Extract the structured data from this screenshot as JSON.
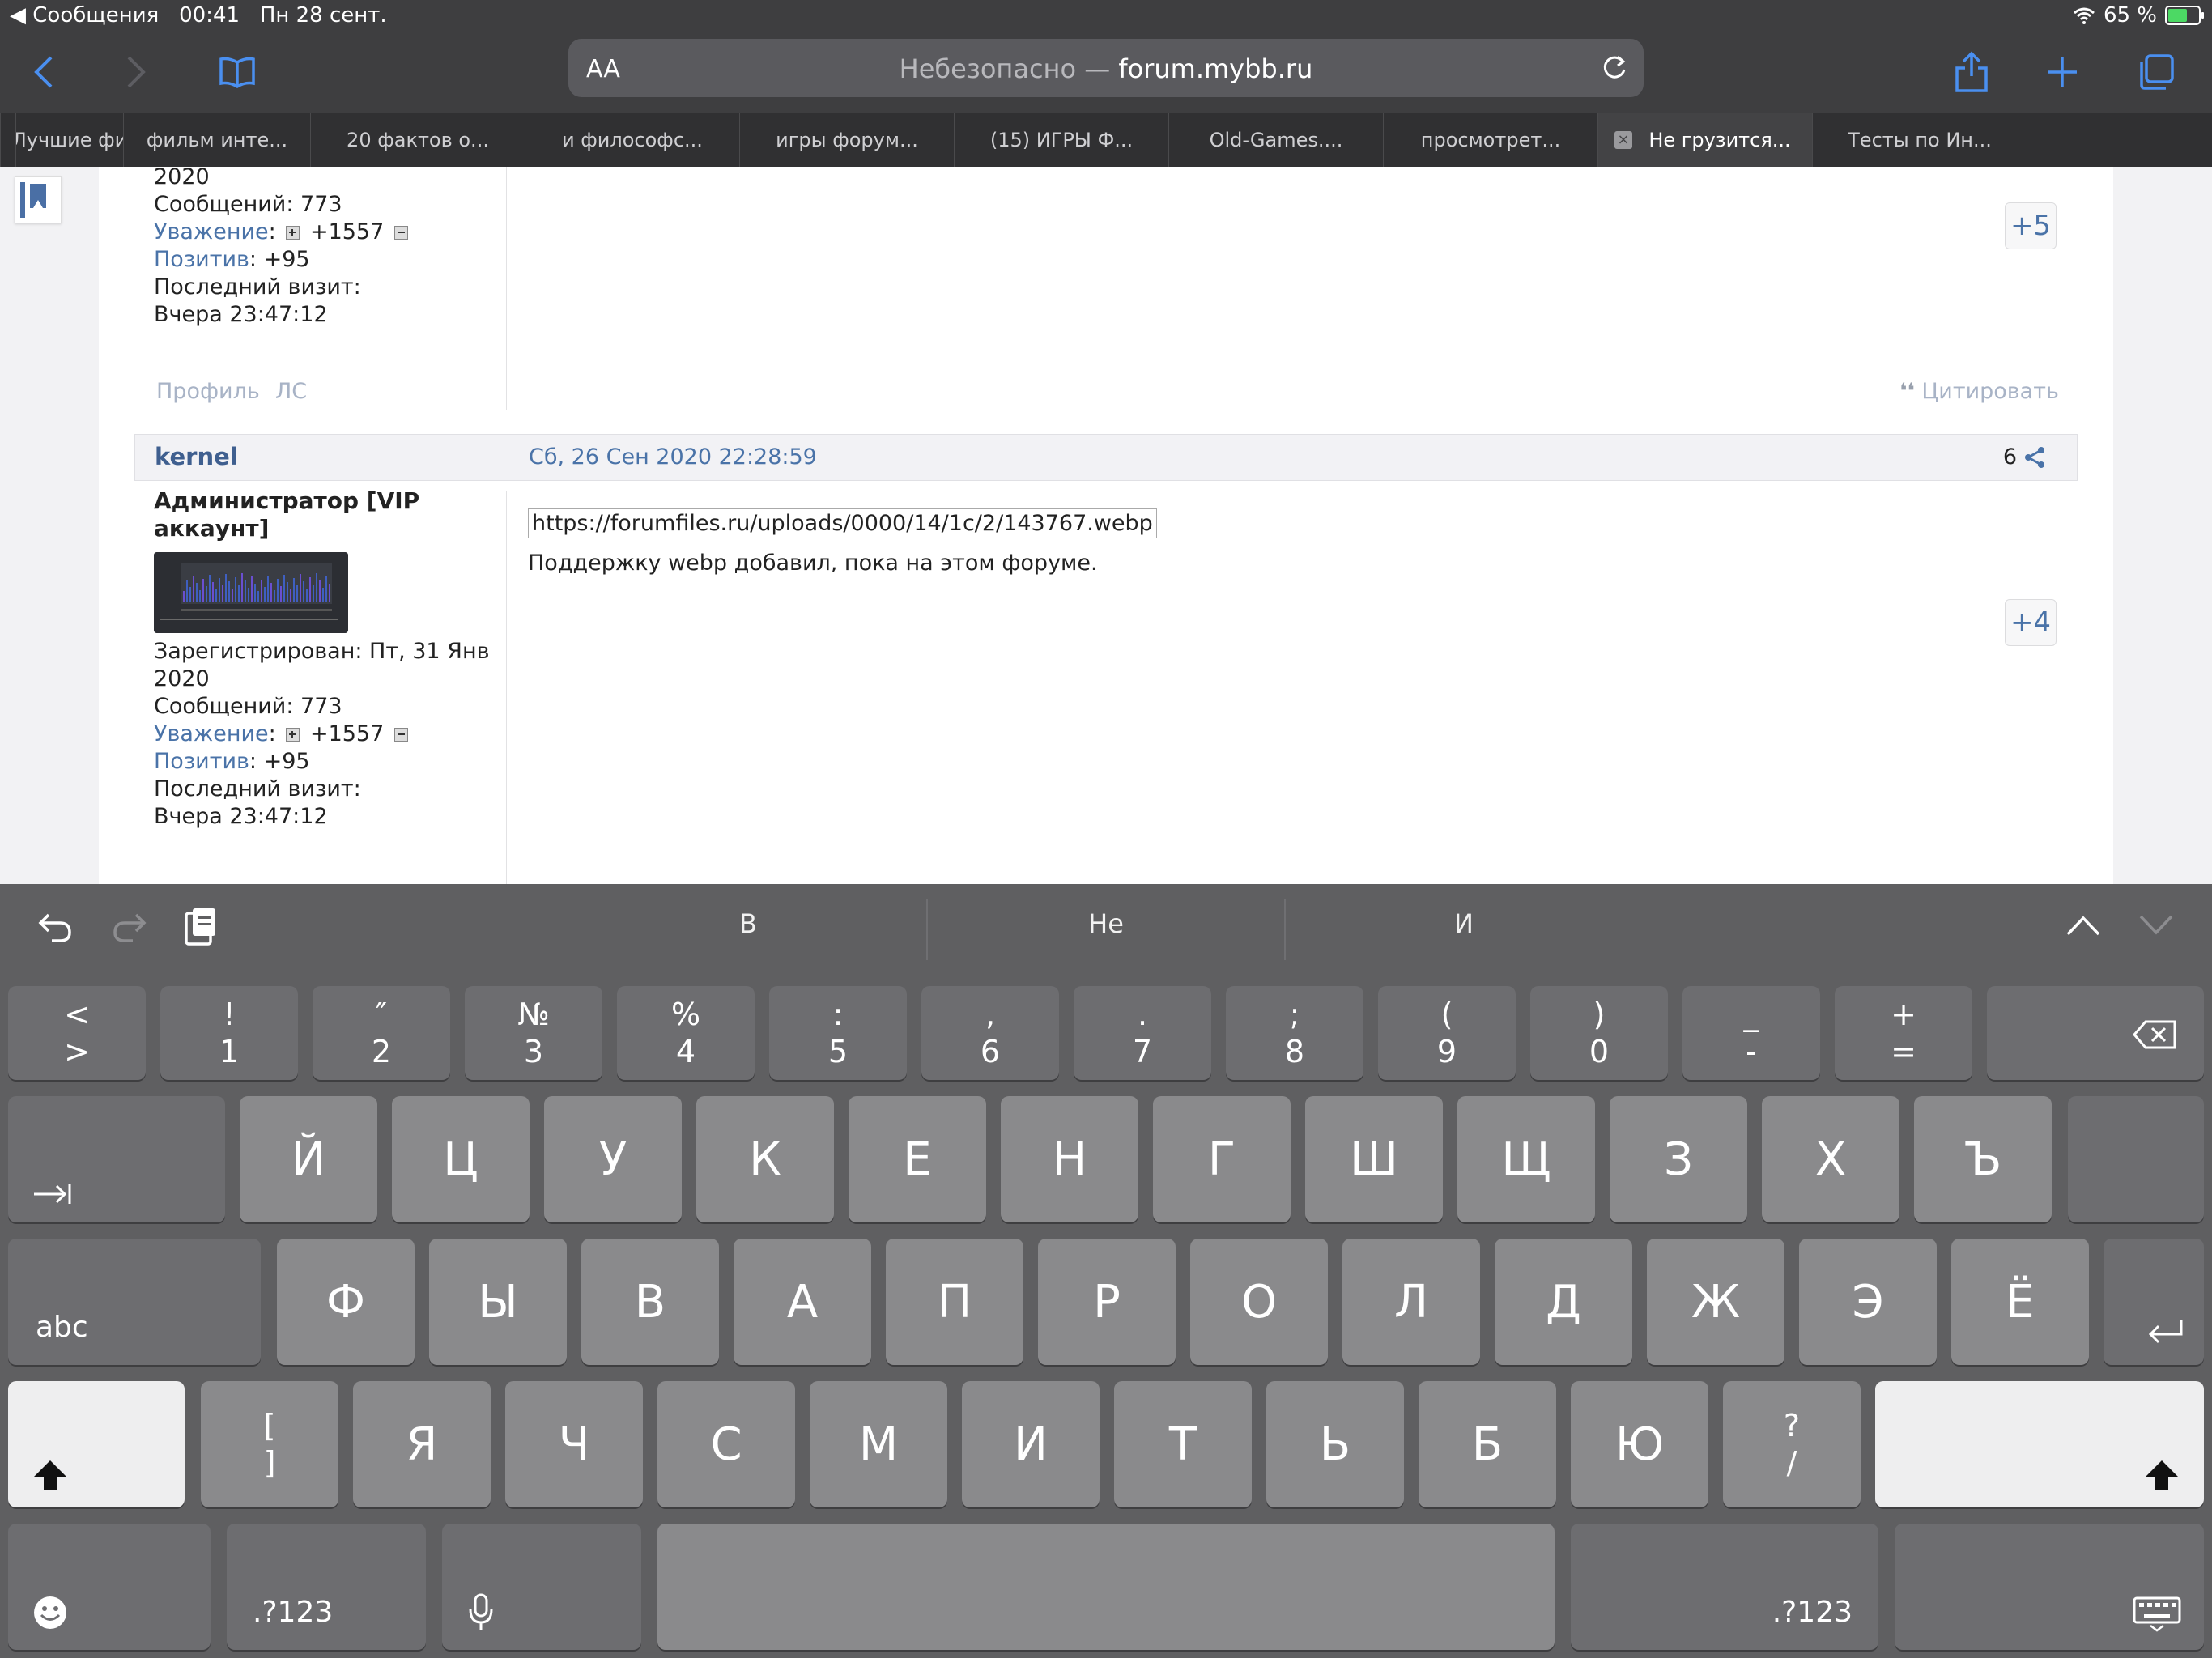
{
  "status": {
    "back_app": "◀ Сообщения",
    "time": "00:41",
    "date": "Пн 28 сент.",
    "battery": "65 %",
    "battery_level": 0.65
  },
  "browser": {
    "aa": "AA",
    "url_prefix": "Небезопасно — ",
    "url_host": "forum.mybb.ru"
  },
  "tabs": [
    {
      "label": "",
      "active": false
    },
    {
      "label": "Лучшие фи",
      "active": false
    },
    {
      "label": "фильм инте...",
      "active": false
    },
    {
      "label": "20 фактов о...",
      "active": false
    },
    {
      "label": "и философс...",
      "active": false
    },
    {
      "label": "игры форум...",
      "active": false
    },
    {
      "label": "(15) ИГРЫ Ф...",
      "active": false
    },
    {
      "label": "Old-Games....",
      "active": false
    },
    {
      "label": "просмотрет...",
      "active": false
    },
    {
      "label": "Не грузится...",
      "active": true
    },
    {
      "label": "Тесты по Ин...",
      "active": false
    }
  ],
  "prev_post": {
    "reg_tail": "2020",
    "posts_line": "Сообщений: 773",
    "respect_label": "Уважение",
    "respect_value": "+1557",
    "positive_label": "Позитив",
    "positive_value": ": +95",
    "last_visit_label": "Последний визит:",
    "last_visit_value": "Вчера 23:47:12",
    "vote": "+5",
    "profile": "Профиль",
    "pm": "ЛС",
    "quote": "Цитировать"
  },
  "post": {
    "author": "kernel",
    "date": "Сб, 26 Сен 2020 22:28:59",
    "number": "6",
    "rank_line1": "Администратор [VIP",
    "rank_line2": "аккаунт]",
    "reg_line1": "Зарегистрирован: Пт, 31 Янв",
    "reg_line2": "2020",
    "posts_line": "Сообщений: 773",
    "respect_label": "Уважение",
    "respect_value": "+1557",
    "positive_label": "Позитив",
    "positive_value": ": +95",
    "last_visit_label": "Последний визит:",
    "last_visit_value": "Вчера 23:47:12",
    "link": "https://forumfiles.ru/uploads/0000/14/1c/2/143767.webp",
    "text": "Поддержку webp добавил, пока на этом форуме.",
    "vote": "+4"
  },
  "keyboard": {
    "suggestions": [
      "В",
      "Не",
      "И"
    ],
    "row1": [
      {
        "top": "<",
        "bottom": ">"
      },
      {
        "top": "!",
        "bottom": "1"
      },
      {
        "top": "″",
        "bottom": "2"
      },
      {
        "top": "№",
        "bottom": "3"
      },
      {
        "top": "%",
        "bottom": "4"
      },
      {
        "top": ":",
        "bottom": "5"
      },
      {
        "top": ",",
        "bottom": "6"
      },
      {
        "top": ".",
        "bottom": "7"
      },
      {
        "top": ";",
        "bottom": "8"
      },
      {
        "top": "(",
        "bottom": "9"
      },
      {
        "top": ")",
        "bottom": "0"
      },
      {
        "top": "_",
        "bottom": "-"
      },
      {
        "top": "+",
        "bottom": "="
      }
    ],
    "row2": [
      "Й",
      "Ц",
      "У",
      "К",
      "Е",
      "Н",
      "Г",
      "Ш",
      "Щ",
      "З",
      "Х",
      "Ъ"
    ],
    "row3": [
      "Ф",
      "Ы",
      "В",
      "А",
      "П",
      "Р",
      "О",
      "Л",
      "Д",
      "Ж",
      "Э",
      "Ё"
    ],
    "row4": [
      {
        "top": "[",
        "bottom": "]"
      },
      "Я",
      "Ч",
      "С",
      "М",
      "И",
      "Т",
      "Ь",
      "Б",
      "Ю",
      {
        "top": "?",
        "bottom": "/"
      }
    ],
    "abc": "abc",
    "num": ".?123"
  }
}
